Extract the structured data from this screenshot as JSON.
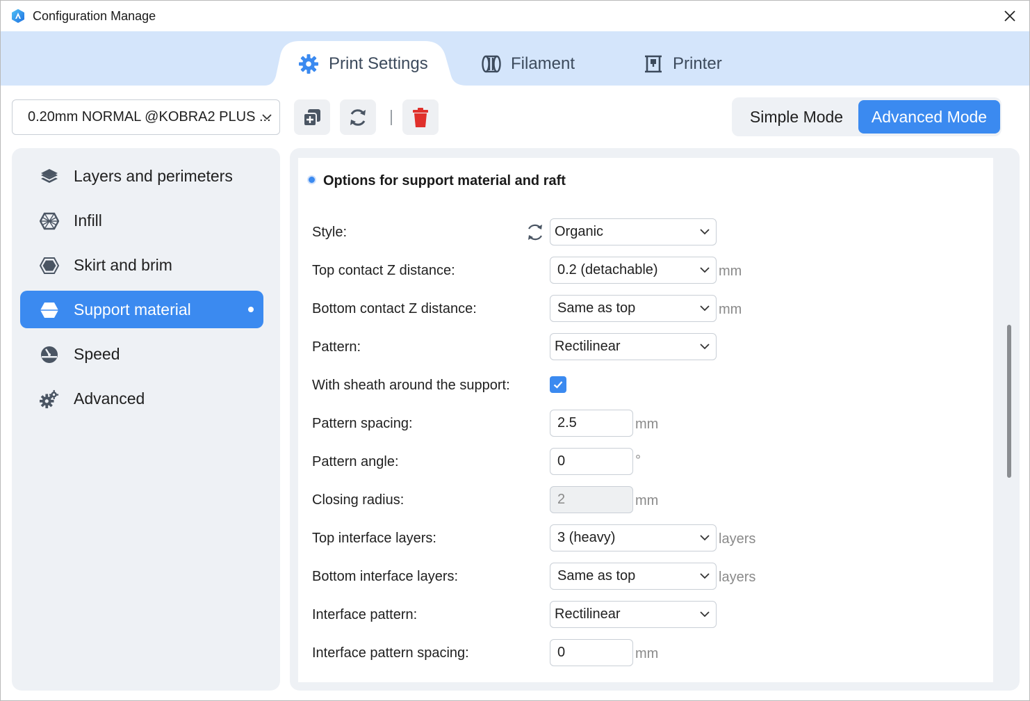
{
  "window": {
    "title": "Configuration Manage",
    "accent_color": "#3b8af0",
    "tab_band_color": "#d4e5fb"
  },
  "tabs": [
    {
      "label": "Print Settings",
      "icon": "gear-icon",
      "active": true
    },
    {
      "label": "Filament",
      "icon": "filament-spool-icon",
      "active": false
    },
    {
      "label": "Printer",
      "icon": "printer-icon",
      "active": false
    }
  ],
  "toolbar": {
    "preset_value": "0.20mm NORMAL @KOBRA2 PLUS ...",
    "buttons": [
      {
        "name": "duplicate-button",
        "icon": "copy-plus-icon"
      },
      {
        "name": "reset-button",
        "icon": "refresh-icon"
      },
      {
        "name": "delete-button",
        "icon": "trash-icon"
      }
    ],
    "delete_color": "#e0302b",
    "modes": {
      "simple": "Simple Mode",
      "advanced": "Advanced Mode",
      "selected": "advanced"
    }
  },
  "sidebar": {
    "items": [
      {
        "label": "Layers and perimeters",
        "icon": "layers-icon",
        "active": false
      },
      {
        "label": "Infill",
        "icon": "infill-hexagon-icon",
        "active": false
      },
      {
        "label": "Skirt and brim",
        "icon": "skirt-hexagon-icon",
        "active": false
      },
      {
        "label": "Support material",
        "icon": "support-icon",
        "active": true,
        "modified": true
      },
      {
        "label": "Speed",
        "icon": "speedometer-icon",
        "active": false
      },
      {
        "label": "Advanced",
        "icon": "gears-icon",
        "active": false
      }
    ]
  },
  "section": {
    "title": "Options for support material and raft",
    "rows": [
      {
        "label": "Style:",
        "kind": "combo-readonly",
        "value": "Organic",
        "unit": "",
        "has_reset": true
      },
      {
        "label": "Top contact Z distance:",
        "kind": "combo-editable",
        "value": "0.2 (detachable)",
        "unit": "mm"
      },
      {
        "label": "Bottom contact Z distance:",
        "kind": "combo-editable",
        "value": "Same as top",
        "unit": "mm"
      },
      {
        "label": "Pattern:",
        "kind": "combo-readonly",
        "value": "Rectilinear",
        "unit": ""
      },
      {
        "label": "With sheath around the support:",
        "kind": "checkbox",
        "checked": true,
        "unit": ""
      },
      {
        "label": "Pattern spacing:",
        "kind": "text",
        "value": "2.5",
        "unit": "mm"
      },
      {
        "label": "Pattern angle:",
        "kind": "text",
        "value": "0",
        "unit": "°"
      },
      {
        "label": "Closing radius:",
        "kind": "text-disabled",
        "value": "2",
        "unit": "mm"
      },
      {
        "label": "Top interface layers:",
        "kind": "combo-editable",
        "value": "3 (heavy)",
        "unit": "layers"
      },
      {
        "label": "Bottom interface layers:",
        "kind": "combo-editable",
        "value": "Same as top",
        "unit": "layers"
      },
      {
        "label": "Interface pattern:",
        "kind": "combo-readonly",
        "value": "Rectilinear",
        "unit": ""
      },
      {
        "label": "Interface pattern spacing:",
        "kind": "text",
        "value": "0",
        "unit": "mm"
      }
    ]
  }
}
